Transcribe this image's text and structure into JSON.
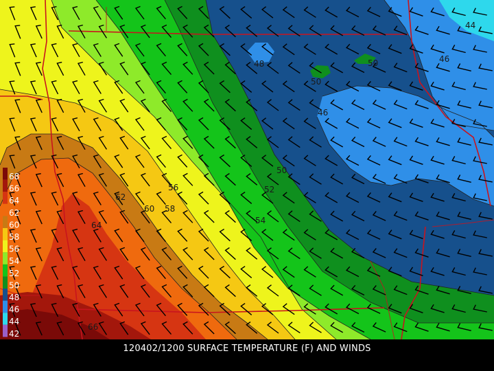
{
  "caption": "120402/1200 SURFACE TEMPERATURE (F) AND WINDS",
  "legend": [
    {
      "label": "68",
      "color": "#7a0a08"
    },
    {
      "label": "66",
      "color": "#a3170c"
    },
    {
      "label": "64",
      "color": "#d63512"
    },
    {
      "label": "62",
      "color": "#ef6a0e"
    },
    {
      "label": "60",
      "color": "#c87a14"
    },
    {
      "label": "58",
      "color": "#f5c813"
    },
    {
      "label": "56",
      "color": "#eef41c"
    },
    {
      "label": "54",
      "color": "#8eea2a"
    },
    {
      "label": "52",
      "color": "#14c41a"
    },
    {
      "label": "50",
      "color": "#0f8f1e"
    },
    {
      "label": "48",
      "color": "#16508c"
    },
    {
      "label": "46",
      "color": "#2f8fe8"
    },
    {
      "label": "44",
      "color": "#2ed8ec"
    },
    {
      "label": "42",
      "color": "#9a5fc8"
    }
  ],
  "contour_labels": [
    {
      "text": "44"
    },
    {
      "text": "46"
    },
    {
      "text": "48"
    },
    {
      "text": "50"
    },
    {
      "text": "50"
    },
    {
      "text": "46"
    },
    {
      "text": "50"
    },
    {
      "text": "52"
    },
    {
      "text": "54"
    },
    {
      "text": "56"
    },
    {
      "text": "58"
    },
    {
      "text": "60"
    },
    {
      "text": "62"
    },
    {
      "text": "64"
    },
    {
      "text": "66"
    }
  ],
  "colors": {
    "background": "#000000",
    "state_borders": "#c8141e",
    "county_borders": "#c8141e",
    "wind_barbs": "#000000",
    "contour_lines": "#222222"
  }
}
